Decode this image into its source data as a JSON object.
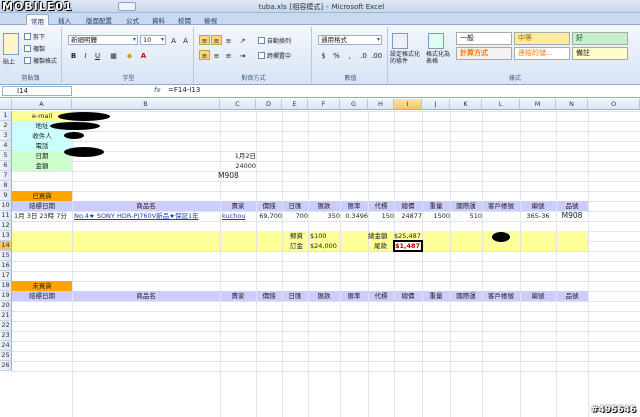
{
  "app": {
    "logo": "MOBILE01",
    "file": "tuba.xls",
    "mode": "[相容模式]",
    "product": "Microsoft Excel"
  },
  "tabs": [
    "常用",
    "插入",
    "版面配置",
    "公式",
    "資料",
    "校閱",
    "檢視"
  ],
  "ribbon": {
    "clipboard": {
      "paste": "貼上",
      "cut": "剪下",
      "copy": "複製",
      "format_painter": "複製格式",
      "label": "剪貼簿"
    },
    "font": {
      "name": "新細明體",
      "size": "10",
      "label": "字型"
    },
    "align": {
      "wrap": "自動換列",
      "merge": "跨欄置中",
      "label": "對齊方式"
    },
    "number": {
      "format": "通用格式",
      "label": "數值"
    },
    "styles": {
      "cond": "設定格式化的條件",
      "table": "格式化為表格",
      "label": "樣式",
      "normal": "一般",
      "medium": "中等",
      "good": "好",
      "calc": "計算方式",
      "linked": "連結的儲...",
      "note": "備註"
    }
  },
  "formula_bar": {
    "cell": "I14",
    "fx": "fx",
    "formula": "=F14-I13"
  },
  "columns": [
    "A",
    "B",
    "C",
    "D",
    "E",
    "F",
    "G",
    "H",
    "I",
    "J",
    "K",
    "L",
    "M",
    "N",
    "O"
  ],
  "rows": [
    "1",
    "2",
    "3",
    "4",
    "5",
    "6",
    "7",
    "8",
    "9",
    "10",
    "11",
    "12",
    "13",
    "14",
    "15",
    "16",
    "17",
    "18",
    "19",
    "20",
    "21",
    "22",
    "23",
    "24",
    "25",
    "26"
  ],
  "cells": {
    "a1": "e-mail",
    "a2": "地址",
    "a3": "收件人",
    "a4": "電話",
    "a5": "日期",
    "a6": "金額",
    "c5": "1月2日",
    "c6": "24000",
    "c7": "M908",
    "a9": "已買貨",
    "hdr": [
      "結標日期",
      "商品名",
      "賣家",
      "價錢",
      "日匯",
      "匯款",
      "匯率",
      "代標",
      "總價",
      "重量",
      "國際運",
      "客戶帳號",
      "編號",
      "品號"
    ],
    "r11": {
      "date": "1月 3日 23時 7分",
      "item": "No.4★ SONY HDR-PJ760V新品★保証1年",
      "seller": "kuchou",
      "price": "69,700",
      "rate_day": "700",
      "remit": "350",
      "rate": "0.3496",
      "agent": "150",
      "total": "24877",
      "weight": "1500",
      "intl": "510",
      "id": "365-36",
      "code": "M908"
    },
    "r13": {
      "label1": "郵資",
      "val1": "$100",
      "label2": "總金額",
      "val2": "$25,487"
    },
    "r14": {
      "label1": "訂金",
      "val1": "$24,000",
      "label2": "尾款",
      "val2": "$1,487"
    },
    "a18": "未買貨"
  },
  "watermark": "#495646"
}
